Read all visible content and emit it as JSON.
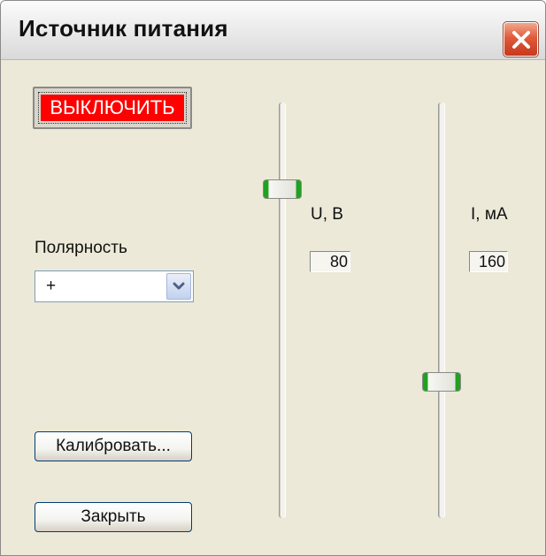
{
  "window": {
    "title": "Источник питания"
  },
  "icons": {
    "close": "close-icon",
    "dropdown": "chevron-down-icon"
  },
  "colors": {
    "power_button_bg": "#ff0000",
    "power_button_text": "#ffffff",
    "slider_thumb_accent": "#21a121",
    "close_button": "#e05a3a",
    "window_bg": "#ece9d8"
  },
  "controls": {
    "power_button_label": "ВЫКЛЮЧИТЬ",
    "polarity_label": "Полярность",
    "polarity_value": "+",
    "calibrate_label": "Калибровать...",
    "close_label": "Закрыть"
  },
  "voltage": {
    "label": "U, В",
    "value": "80"
  },
  "current": {
    "label": "I, мА",
    "value": "160"
  }
}
